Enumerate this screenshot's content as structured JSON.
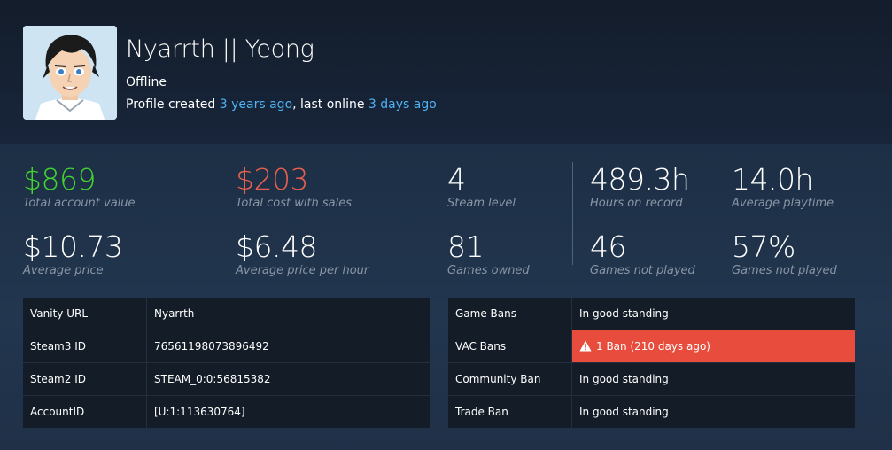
{
  "profile": {
    "name": "Nyarrth || Yeong",
    "status": "Offline",
    "created_prefix": "Profile created ",
    "created_ago": "3 years ago",
    "online_prefix": ", last online ",
    "online_ago": "3 days ago",
    "link_color": "#4fb2f2"
  },
  "stats": {
    "account_value": {
      "value": "$869",
      "label": "Total account value",
      "color": "#43d42f"
    },
    "cost_with_sales": {
      "value": "$203",
      "label": "Total cost with sales",
      "color": "#e8604e"
    },
    "steam_level": {
      "value": "4",
      "label": "Steam level"
    },
    "hours_on_record": {
      "value": "489.3h",
      "label": "Hours on record"
    },
    "avg_playtime": {
      "value": "14.0h",
      "label": "Average playtime"
    },
    "avg_price": {
      "value": "$10.73",
      "label": "Average price"
    },
    "avg_price_hour": {
      "value": "$6.48",
      "label": "Average price per hour"
    },
    "games_owned": {
      "value": "81",
      "label": "Games owned"
    },
    "games_not_played": {
      "value": "46",
      "label": "Games not played"
    },
    "games_not_played_pct": {
      "value": "57%",
      "label": "Games not played"
    }
  },
  "ids": {
    "rows": [
      {
        "key": "Vanity URL",
        "value": "Nyarrth"
      },
      {
        "key": "Steam3 ID",
        "value": "76561198073896492"
      },
      {
        "key": "Steam2 ID",
        "value": "STEAM_0:0:56815382"
      },
      {
        "key": "AccountID",
        "value": "[U:1:113630764]"
      }
    ]
  },
  "bans": {
    "rows": [
      {
        "key": "Game Bans",
        "value": "In good standing"
      },
      {
        "key": "VAC Bans",
        "value": "1 Ban (210 days ago)",
        "alert": true,
        "icon": "warning-icon"
      },
      {
        "key": "Community Ban",
        "value": "In good standing"
      },
      {
        "key": "Trade Ban",
        "value": "In good standing"
      }
    ],
    "alert_color": "#e74c3c"
  }
}
